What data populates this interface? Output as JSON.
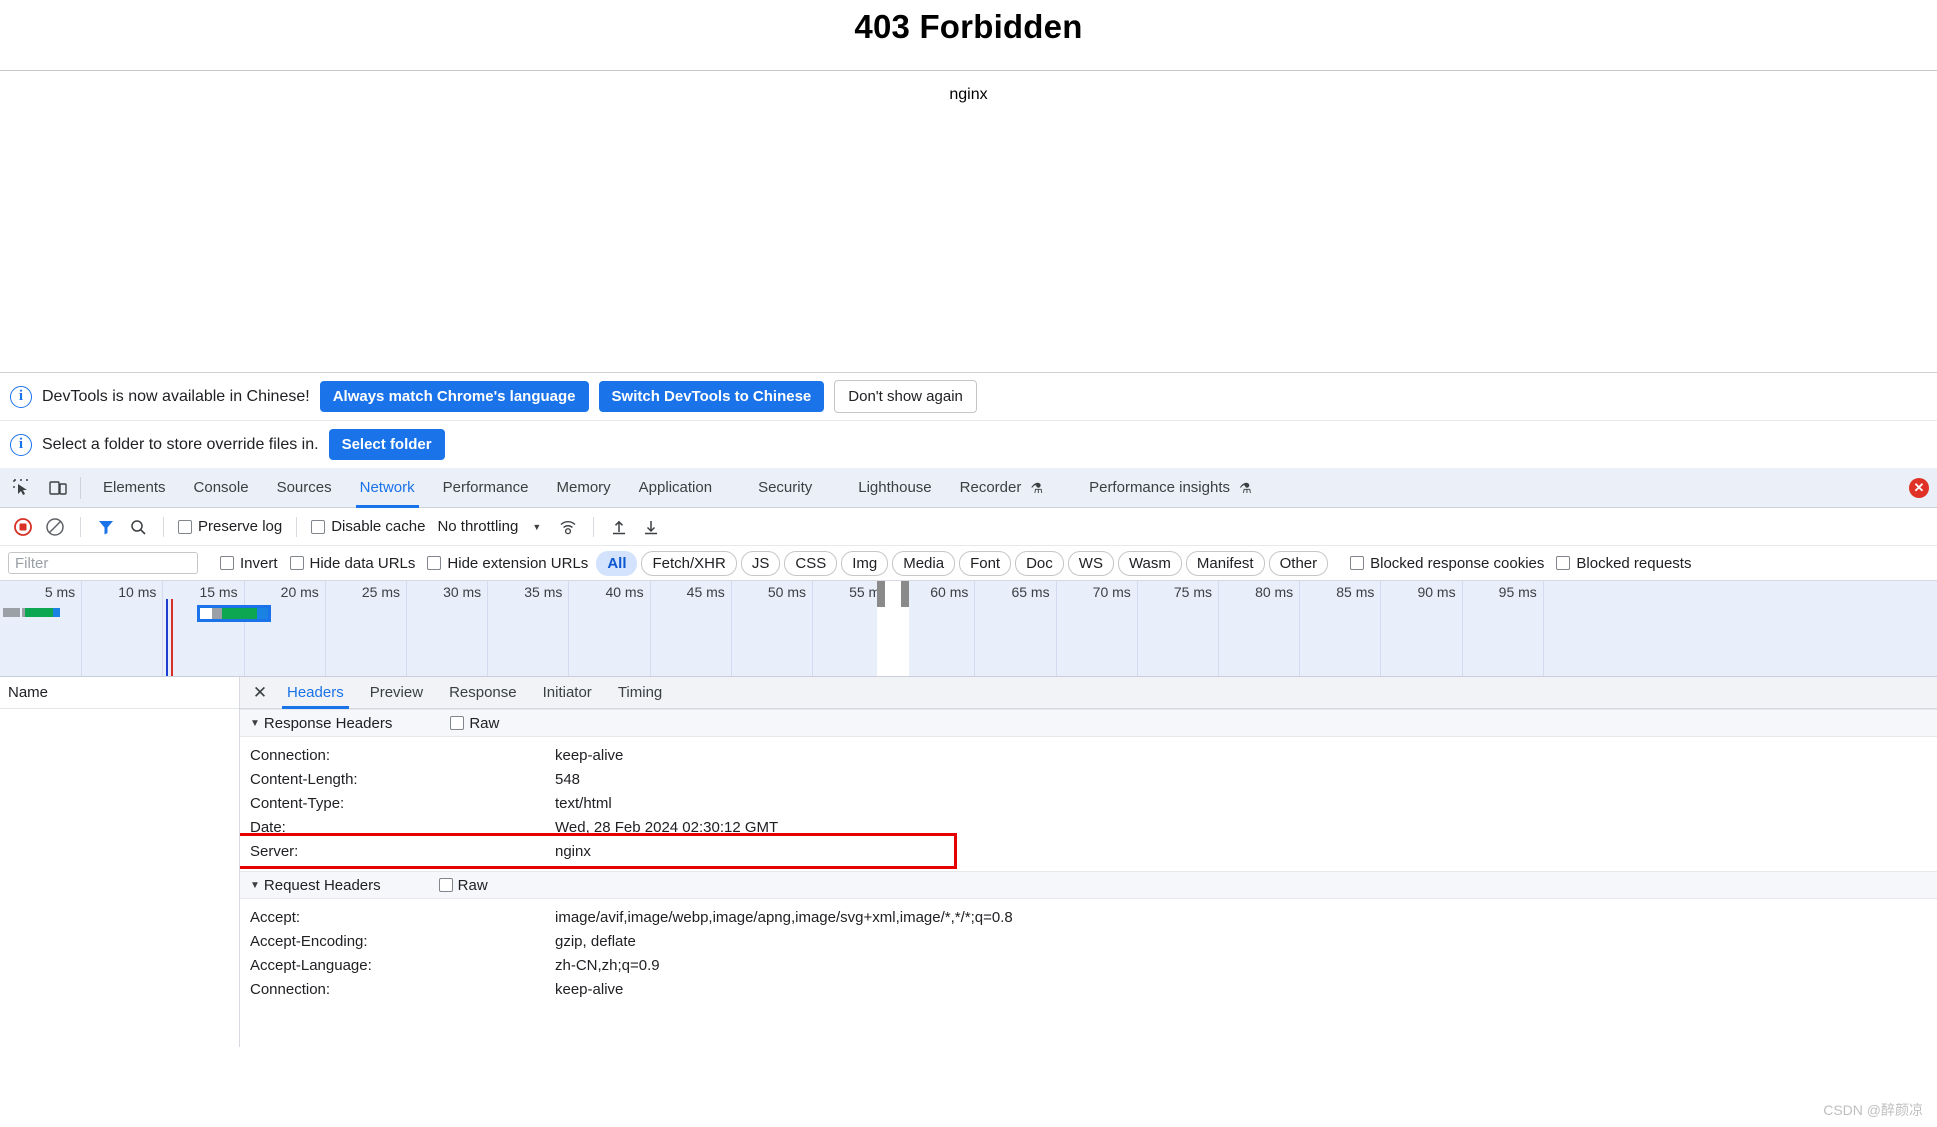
{
  "page": {
    "title": "403 Forbidden",
    "server_line": "nginx"
  },
  "infobars": [
    {
      "icon": "info-icon",
      "text": "DevTools is now available in Chinese!",
      "buttons": [
        {
          "label": "Always match Chrome's language",
          "style": "blue"
        },
        {
          "label": "Switch DevTools to Chinese",
          "style": "blue"
        },
        {
          "label": "Don't show again",
          "style": "grey"
        }
      ]
    },
    {
      "icon": "info-icon",
      "text": "Select a folder to store override files in.",
      "buttons": [
        {
          "label": "Select folder",
          "style": "blue"
        }
      ]
    }
  ],
  "devtools": {
    "left_icons": [
      {
        "name": "inspect-element-icon"
      },
      {
        "name": "device-toolbar-icon"
      }
    ],
    "tabs": [
      {
        "label": "Elements",
        "active": false,
        "flask": false
      },
      {
        "label": "Console",
        "active": false,
        "flask": false
      },
      {
        "label": "Sources",
        "active": false,
        "flask": false
      },
      {
        "label": "Network",
        "active": true,
        "flask": false
      },
      {
        "label": "Performance",
        "active": false,
        "flask": false
      },
      {
        "label": "Memory",
        "active": false,
        "flask": false
      },
      {
        "label": "Application",
        "active": false,
        "flask": false
      },
      {
        "label": "Security",
        "active": false,
        "flask": false
      },
      {
        "label": "Lighthouse",
        "active": false,
        "flask": false
      },
      {
        "label": "Recorder",
        "active": false,
        "flask": true
      },
      {
        "label": "Performance insights",
        "active": false,
        "flask": true
      }
    ],
    "error_badge": "✕",
    "network_toolbar": {
      "record_icon": "record-stop-icon",
      "clear_icon": "clear-network-log-icon",
      "filter_icon": "filter-icon",
      "search_icon": "search-icon",
      "preserve_log_label": "Preserve log",
      "disable_cache_label": "Disable cache",
      "throttling_label": "No throttling",
      "throttle_caret": "▼",
      "network_conditions_icon": "network-conditions-icon",
      "import_icon": "import-har-icon",
      "export_icon": "export-har-icon"
    },
    "filter_row": {
      "filter_placeholder": "Filter",
      "filter_value": "",
      "invert_label": "Invert",
      "hide_data_urls_label": "Hide data URLs",
      "hide_extension_urls_label": "Hide extension URLs",
      "types": [
        {
          "label": "All",
          "selected": true
        },
        {
          "label": "Fetch/XHR",
          "selected": false
        },
        {
          "label": "JS",
          "selected": false
        },
        {
          "label": "CSS",
          "selected": false
        },
        {
          "label": "Img",
          "selected": false
        },
        {
          "label": "Media",
          "selected": false
        },
        {
          "label": "Font",
          "selected": false
        },
        {
          "label": "Doc",
          "selected": false
        },
        {
          "label": "WS",
          "selected": false
        },
        {
          "label": "Wasm",
          "selected": false
        },
        {
          "label": "Manifest",
          "selected": false
        },
        {
          "label": "Other",
          "selected": false
        }
      ],
      "blocked_response_cookies_label": "Blocked response cookies",
      "blocked_requests_label": "Blocked requests"
    },
    "overview": {
      "ticks": [
        "5 ms",
        "10 ms",
        "15 ms",
        "20 ms",
        "25 ms",
        "30 ms",
        "35 ms",
        "40 ms",
        "45 ms",
        "50 ms",
        "55 ms",
        "60 ms",
        "65 ms",
        "70 ms",
        "75 ms",
        "80 ms",
        "85 ms",
        "90 ms",
        "95 ms"
      ],
      "scrubber_center_ms": 55,
      "bars": [
        {
          "name": "request-bar-1",
          "start_ms": 0.2,
          "end_ms": 3.7,
          "color_wait": "#9aa0a6",
          "color_download": "#0ca750",
          "color_tail": "#1a82e2",
          "selected": false
        },
        {
          "name": "request-bar-2",
          "start_ms": 12.3,
          "end_ms": 16.5,
          "color_wait": "#9aa0a6",
          "color_download": "#0ca750",
          "color_tail": "#1a82e2",
          "selected": true
        }
      ],
      "event_lines": [
        {
          "name": "dom-content-loaded-line",
          "at_ms": 10.2,
          "color": "#1a3fd1"
        },
        {
          "name": "load-event-line",
          "at_ms": 10.5,
          "color": "#d93025"
        }
      ]
    },
    "request_list": {
      "column_name": "Name",
      "rows": []
    },
    "detail_tabs": [
      {
        "label": "Headers",
        "active": true
      },
      {
        "label": "Preview",
        "active": false
      },
      {
        "label": "Response",
        "active": false
      },
      {
        "label": "Initiator",
        "active": false
      },
      {
        "label": "Timing",
        "active": false
      }
    ],
    "close_icon": "✕",
    "sections": [
      {
        "name": "response-headers-section",
        "title": "Response Headers",
        "triangle": "▼",
        "raw_label": "Raw",
        "rows": [
          {
            "name": "Connection:",
            "value": "keep-alive",
            "highlight": false
          },
          {
            "name": "Content-Length:",
            "value": "548",
            "highlight": false
          },
          {
            "name": "Content-Type:",
            "value": "text/html",
            "highlight": false
          },
          {
            "name": "Date:",
            "value": "Wed, 28 Feb 2024 02:30:12 GMT",
            "highlight": false
          },
          {
            "name": "Server:",
            "value": "nginx",
            "highlight": true
          }
        ]
      },
      {
        "name": "request-headers-section",
        "title": "Request Headers",
        "triangle": "▼",
        "raw_label": "Raw",
        "rows": [
          {
            "name": "Accept:",
            "value": "image/avif,image/webp,image/apng,image/svg+xml,image/*,*/*;q=0.8",
            "highlight": false
          },
          {
            "name": "Accept-Encoding:",
            "value": "gzip, deflate",
            "highlight": false
          },
          {
            "name": "Accept-Language:",
            "value": "zh-CN,zh;q=0.9",
            "highlight": false
          },
          {
            "name": "Connection:",
            "value": "keep-alive",
            "highlight": false
          }
        ]
      }
    ],
    "highlight_color": "#e60000"
  },
  "watermark": "CSDN @醉颜凉"
}
